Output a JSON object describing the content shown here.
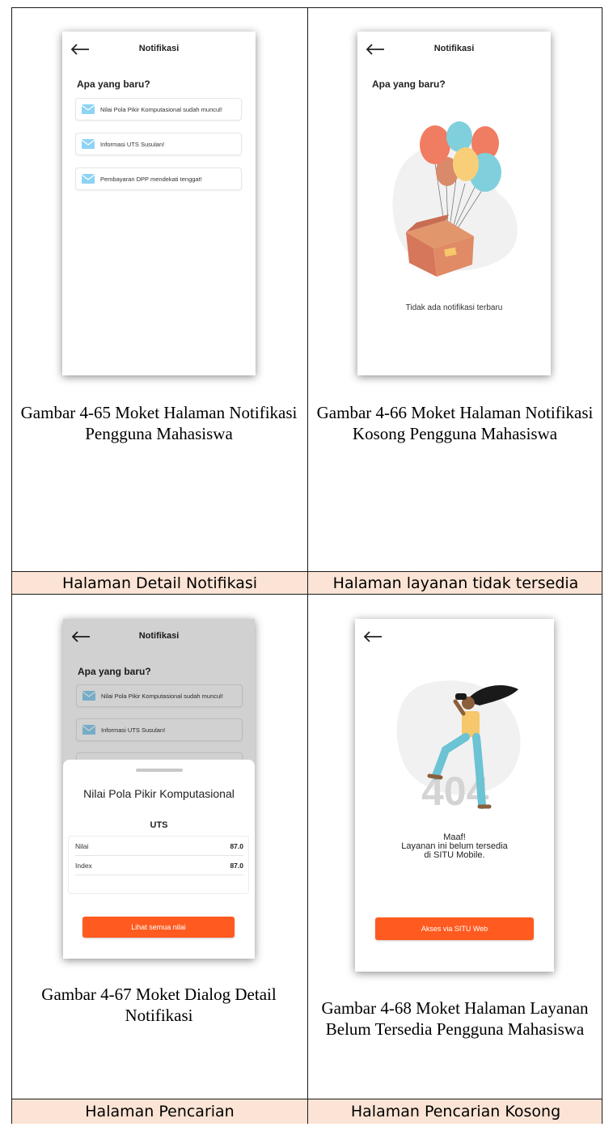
{
  "cells": [
    {
      "caption": "Gambar 4-65 Moket Halaman Notifikasi Pengguna Mahasiswa",
      "screen": {
        "title": "Notifikasi",
        "section": "Apa yang baru?",
        "items": [
          {
            "text": "Nilai Pola Pikir Komputasional sudah muncul!"
          },
          {
            "text": "Informasi UTS Susulan!"
          },
          {
            "text": "Pembayaran DPP mendekati tenggat!"
          }
        ]
      }
    },
    {
      "caption": "Gambar 4-66 Moket Halaman Notifikasi Kosong Pengguna Mahasiswa",
      "screen": {
        "title": "Notifikasi",
        "section": "Apa yang baru?",
        "empty_text": "Tidak ada notifikasi terbaru"
      }
    },
    {
      "caption": "Gambar 4-67 Moket Dialog Detail Notifikasi",
      "screen": {
        "title": "Notifikasi",
        "section": "Apa yang baru?",
        "items": [
          {
            "text": "Nilai Pola Pikir Komputasional sudah muncul!"
          },
          {
            "text": "Informasi UTS Susulan!"
          }
        ],
        "dialog": {
          "title": "Nilai Pola Pikir Komputasional",
          "subtitle": "UTS",
          "rows": [
            {
              "label": "Nilai",
              "value": "87.0"
            },
            {
              "label": "Index",
              "value": "87.0"
            }
          ],
          "button": "Lihat semua nilai"
        }
      }
    },
    {
      "caption": "Gambar 4-68 Moket Halaman Layanan Belum Tersedia Pengguna Mahasiswa",
      "screen": {
        "code": "404",
        "message_line1": "Maaf!",
        "message_line2": "Layanan ini belum tersedia",
        "message_line3": "di SITU Mobile.",
        "button": "Akses via SITU Web"
      }
    }
  ],
  "row_labels": [
    {
      "left": "Halaman Detail Notifikasi",
      "right": "Halaman layanan tidak tersedia"
    },
    {
      "left": "Halaman Pencarian",
      "right": "Halaman Pencarian Kosong"
    }
  ],
  "colors": {
    "label_bg": "#fbe4d5",
    "accent": "#ff5a1f",
    "mail_icon": "#8fd3f4"
  }
}
